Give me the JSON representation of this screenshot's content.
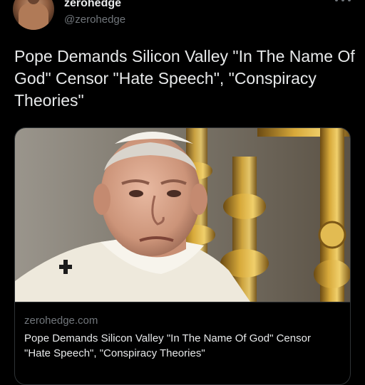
{
  "tweet": {
    "display_name": "zerohedge",
    "handle": "@zerohedge",
    "text": "Pope Demands Silicon Valley \"In The Name Of God\" Censor \"Hate Speech\", \"Conspiracy Theories\""
  },
  "card": {
    "domain": "zerohedge.com",
    "title": "Pope Demands Silicon Valley \"In The Name Of God\" Censor \"Hate Speech\", \"Conspiracy Theories\""
  },
  "colors": {
    "background": "#000000",
    "text_primary": "#e7e9ea",
    "text_secondary": "#71767b",
    "border": "#2f3336"
  },
  "icons": [
    "more-icon",
    "cross-icon"
  ]
}
